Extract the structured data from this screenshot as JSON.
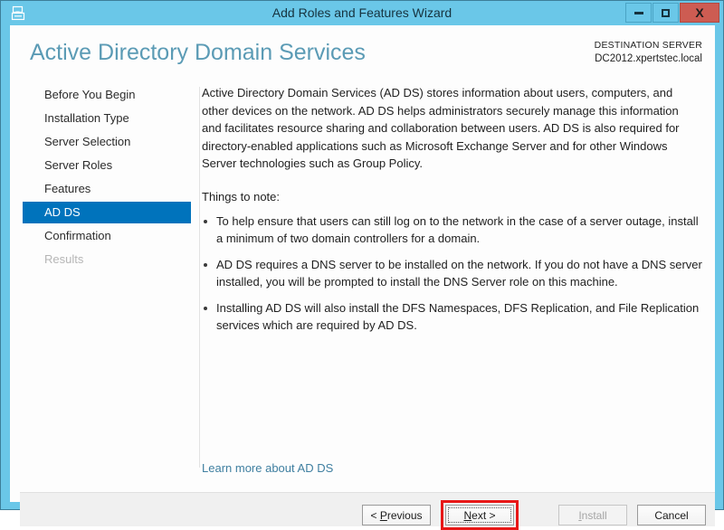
{
  "window": {
    "title": "Add Roles and Features Wizard",
    "icon": "server-wizard-icon",
    "controls": {
      "minimize": "–",
      "maximize": "□",
      "close": "X"
    }
  },
  "header": {
    "page_title": "Active Directory Domain Services",
    "destination_label": "DESTINATION SERVER",
    "destination_value": "DC2012.xpertstec.local"
  },
  "sidebar": {
    "items": [
      {
        "label": "Before You Begin",
        "state": "normal"
      },
      {
        "label": "Installation Type",
        "state": "normal"
      },
      {
        "label": "Server Selection",
        "state": "normal"
      },
      {
        "label": "Server Roles",
        "state": "normal"
      },
      {
        "label": "Features",
        "state": "normal"
      },
      {
        "label": "AD DS",
        "state": "selected"
      },
      {
        "label": "Confirmation",
        "state": "normal"
      },
      {
        "label": "Results",
        "state": "disabled"
      }
    ]
  },
  "content": {
    "intro": "Active Directory Domain Services (AD DS) stores information about users, computers, and other devices on the network.  AD DS helps administrators securely manage this information and facilitates resource sharing and collaboration between users.  AD DS is also required for directory-enabled applications such as Microsoft Exchange Server and for other Windows Server technologies such as Group Policy.",
    "note_heading": "Things to note:",
    "bullets": [
      "To help ensure that users can still log on to the network in the case of a server outage, install a minimum of two domain controllers for a domain.",
      "AD DS requires a DNS server to be installed on the network.  If you do not have a DNS server installed, you will be prompted to install the DNS Server role on this machine.",
      "Installing AD DS will also install the DFS Namespaces, DFS Replication, and File Replication services which are required by AD DS."
    ],
    "learn_more": "Learn more about AD DS"
  },
  "footer": {
    "previous": "< Previous",
    "next": "Next >",
    "install": "Install",
    "cancel": "Cancel",
    "install_enabled": false,
    "next_focused": true
  },
  "colors": {
    "title_bar": "#6ac7e8",
    "close_button": "#cd5c52",
    "selection": "#0073bc",
    "page_title": "#5b9bb5",
    "link": "#3f7fa0",
    "annotation": "#e81717"
  }
}
